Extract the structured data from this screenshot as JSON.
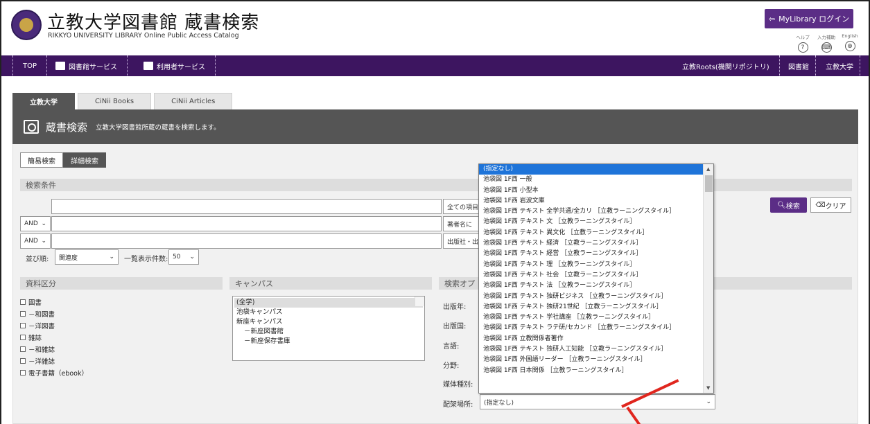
{
  "header": {
    "title_jp": "立教大学図書館  蔵書検索",
    "title_en": "RIKKYO UNIVERSITY LIBRARY Online Public Access Catalog",
    "mylibrary_label": "MyLibrary ログイン",
    "help_items": [
      {
        "label": "ヘルプ",
        "icon": "?"
      },
      {
        "label": "入力補助",
        "icon": "⌨"
      },
      {
        "label": "English",
        "icon": "⊕"
      }
    ]
  },
  "nav": {
    "left": [
      "TOP",
      "図書館サービス",
      "利用者サービス"
    ],
    "right": [
      "立教Roots(機関リポジトリ)",
      "図書館",
      "立教大学"
    ]
  },
  "tabs": [
    "立教大学",
    "CiNii Books",
    "CiNii Articles"
  ],
  "search_header": {
    "title": "蔵書検索",
    "subtitle": "立教大学図書館所蔵の蔵書を検索します。"
  },
  "mode": [
    "簡易検索",
    "詳細検索"
  ],
  "conditions": {
    "title": "検索条件",
    "and_label": "AND",
    "field_selects": [
      "全ての項目",
      "著者名に",
      "出版社・出"
    ],
    "sort_label": "並び順:",
    "sort_value": "関連度",
    "count_label": "一覧表示件数:",
    "count_value": "50",
    "search_button": "検索",
    "clear_button": "クリア"
  },
  "material": {
    "title": "資料区分",
    "items": [
      "図書",
      "－和図書",
      "－洋図書",
      "雑誌",
      "－和雑誌",
      "－洋雑誌",
      "電子書籍（ebook）"
    ]
  },
  "campus": {
    "title": "キャンパス",
    "items": [
      "(全学)",
      "池袋キャンパス",
      "新座キャンパス",
      "－新座図書館",
      "－新座保存書庫"
    ]
  },
  "options": {
    "title": "検索オプ",
    "labels": [
      "出版年:",
      "出版国:",
      "言語:",
      "分野:",
      "媒体種別:",
      "配架場所:"
    ],
    "location_value": "(指定なし)"
  },
  "dropdown": {
    "items": [
      "(指定なし)",
      "池袋図 1F西 一般",
      "池袋図 1F西 小型本",
      "池袋図 1F西 岩波文庫",
      "池袋図 1F西 テキスト 全学共通/全カリ ［立教ラーニングスタイル］",
      "池袋図 1F西 テキスト 文 ［立教ラーニングスタイル］",
      "池袋図 1F西 テキスト 異文化 ［立教ラーニングスタイル］",
      "池袋図 1F西 テキスト 経済 ［立教ラーニングスタイル］",
      "池袋図 1F西 テキスト 経営 ［立教ラーニングスタイル］",
      "池袋図 1F西 テキスト 理 ［立教ラーニングスタイル］",
      "池袋図 1F西 テキスト 社会 ［立教ラーニングスタイル］",
      "池袋図 1F西 テキスト 法 ［立教ラーニングスタイル］",
      "池袋図 1F西 テキスト 独研ビジネス ［立教ラーニングスタイル］",
      "池袋図 1F西 テキスト 独研21世紀 ［立教ラーニングスタイル］",
      "池袋図 1F西 テキスト 学社講座 ［立教ラーニングスタイル］",
      "池袋図 1F西 テキスト ラテ研/セカンド ［立教ラーニングスタイル］",
      "池袋図 1F西 立教関係者著作",
      "池袋図 1F西 テキスト 独研人工知能 ［立教ラーニングスタイル］",
      "池袋図 1F西 外国語リーダー ［立教ラーニングスタイル］",
      "池袋図 1F西 日本関係 ［立教ラーニングスタイル］"
    ]
  },
  "colors": {
    "brand": "#3d1560",
    "accent": "#5b2d86",
    "selected": "#1e74d9",
    "annotation": "#e0261e"
  }
}
